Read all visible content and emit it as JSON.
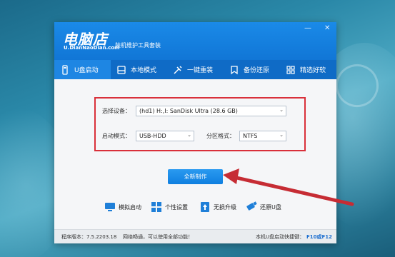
{
  "app": {
    "logo": "电脑店",
    "logo_sub": "U.DianNaoDian.com",
    "slogan": "装机维护工具套装",
    "min_button": "—",
    "close_button": "✕"
  },
  "tabs": [
    {
      "label": "U盘启动",
      "icon": "usb-drive-icon",
      "active": true
    },
    {
      "label": "本地模式",
      "icon": "local-disk-icon",
      "active": false
    },
    {
      "label": "一键重装",
      "icon": "tools-icon",
      "active": false
    },
    {
      "label": "备份还原",
      "icon": "backup-icon",
      "active": false
    },
    {
      "label": "精选好软",
      "icon": "apps-grid-icon",
      "active": false
    }
  ],
  "form": {
    "device_label": "选择设备：",
    "device_value": "(hd1) H:,I: SanDisk Ultra (28.6 GB)",
    "boot_mode_label": "启动模式：",
    "boot_mode_value": "USB-HDD",
    "partition_label": "分区格式：",
    "partition_value": "NTFS",
    "dropdown_arrow": "⌄"
  },
  "primary_action": "全新制作",
  "tools": [
    {
      "label": "模拟启动",
      "icon": "monitor-icon"
    },
    {
      "label": "个性设置",
      "icon": "grid-settings-icon"
    },
    {
      "label": "无损升级",
      "icon": "upgrade-icon"
    },
    {
      "label": "还原U盘",
      "icon": "usb-restore-icon"
    }
  ],
  "status": {
    "version": "程序版本：7.5.2203.18",
    "network": "网络畅通，可以使用全部功能！",
    "hint_prefix": "本机U盘启动快捷键：",
    "hotkeys": "F10或F12"
  },
  "colors": {
    "accent": "#1176d6",
    "highlight_box": "#d9303a",
    "arrow": "#c62c34"
  }
}
